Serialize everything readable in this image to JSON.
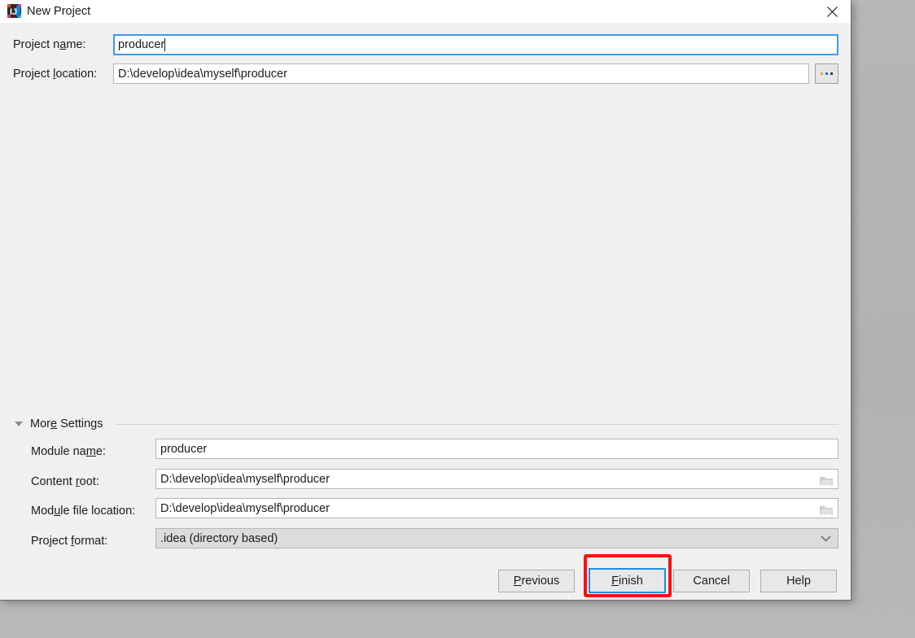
{
  "window": {
    "title": "New Project",
    "icon": "intellij-idea-icon",
    "close_icon": "close-icon",
    "background": "#f0f0f0"
  },
  "form": {
    "project_name": {
      "label_before": "Project n",
      "label_mnemonic": "a",
      "label_after": "me:",
      "value": "producer",
      "focused": true
    },
    "project_location": {
      "label_before": "Project ",
      "label_mnemonic": "l",
      "label_after": "ocation:",
      "value": "D:\\develop\\idea\\myself\\producer"
    },
    "browse_button": {
      "label": "...",
      "icon": "ellipsis-icon",
      "dot_colors": [
        "#e8a33d",
        "#2f6fd0",
        "#3c3c3c"
      ]
    }
  },
  "more_settings": {
    "title_before": "Mor",
    "title_mnemonic": "e",
    "title_after": " Settings",
    "expanded": true,
    "fields": [
      {
        "label_before": "Module na",
        "label_mnemonic": "m",
        "label_after": "e:",
        "value": "producer",
        "has_browse": false
      },
      {
        "label_before": "Content ",
        "label_mnemonic": "r",
        "label_after": "oot:",
        "value": "D:\\develop\\idea\\myself\\producer",
        "has_browse": true,
        "browse_icon": "folder-icon"
      },
      {
        "label_before": "Mod",
        "label_mnemonic": "u",
        "label_after": "le file location:",
        "value": "D:\\develop\\idea\\myself\\producer",
        "has_browse": true,
        "browse_icon": "folder-icon"
      }
    ],
    "project_format": {
      "label_before": "Project ",
      "label_mnemonic": "f",
      "label_after": "ormat:",
      "value": ".idea (directory based)",
      "chevron_icon": "chevron-down-icon"
    }
  },
  "buttons": {
    "previous": {
      "before": "",
      "mnemonic": "P",
      "after": "revious"
    },
    "finish": {
      "before": "",
      "mnemonic": "F",
      "after": "inish",
      "is_default": true
    },
    "cancel": {
      "label": "Cancel"
    },
    "help": {
      "label": "Help"
    }
  },
  "annotation": {
    "shape": "rectangle",
    "color": "#fb0f12",
    "target": "finish-button"
  }
}
